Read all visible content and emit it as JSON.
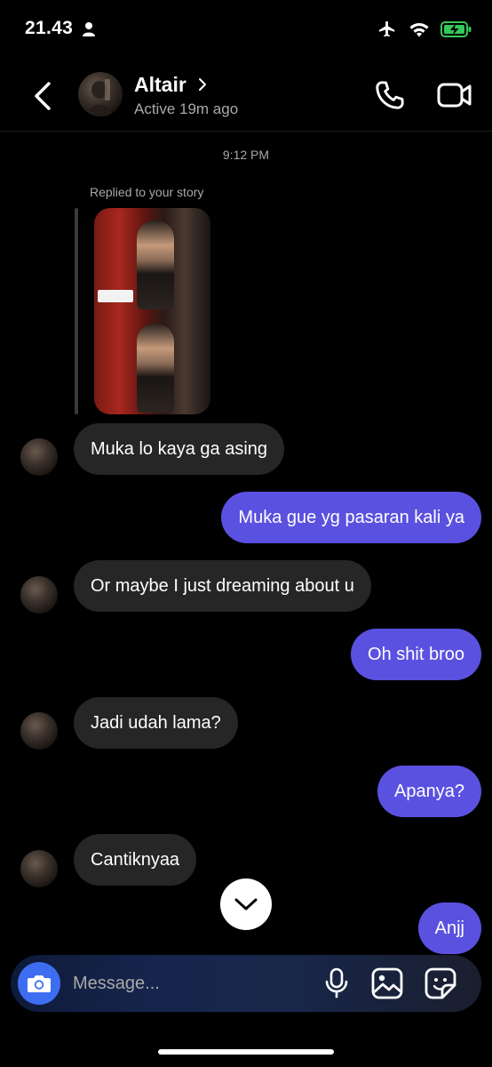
{
  "status_bar": {
    "time": "21.43"
  },
  "header": {
    "contact_name": "Altair",
    "contact_status": "Active 19m ago"
  },
  "chat": {
    "timestamp": "9:12 PM",
    "story_reply_label": "Replied to your story",
    "messages": [
      {
        "direction": "incoming",
        "text": "Muka lo kaya ga asing"
      },
      {
        "direction": "outgoing",
        "text": "Muka gue yg pasaran kali ya"
      },
      {
        "direction": "incoming",
        "text": "Or maybe I just dreaming about u"
      },
      {
        "direction": "outgoing",
        "text": "Oh shit broo"
      },
      {
        "direction": "incoming",
        "text": "Jadi udah lama?"
      },
      {
        "direction": "outgoing",
        "text": "Apanya?"
      },
      {
        "direction": "incoming",
        "text": "Cantiknyaa"
      },
      {
        "direction": "outgoing",
        "text": "Anjj"
      }
    ]
  },
  "composer": {
    "placeholder": "Message..."
  },
  "colors": {
    "outgoing_bubble": "#5b51e0",
    "incoming_bubble": "#262626",
    "camera_button": "#3d6ef2",
    "battery_charging": "#34c759"
  },
  "icons": [
    "person-icon",
    "airplane-icon",
    "wifi-icon",
    "battery-icon",
    "back-chevron-icon",
    "chevron-right-icon",
    "phone-icon",
    "video-camera-icon",
    "chevron-down-icon",
    "camera-icon",
    "microphone-icon",
    "gallery-icon",
    "sticker-icon"
  ]
}
